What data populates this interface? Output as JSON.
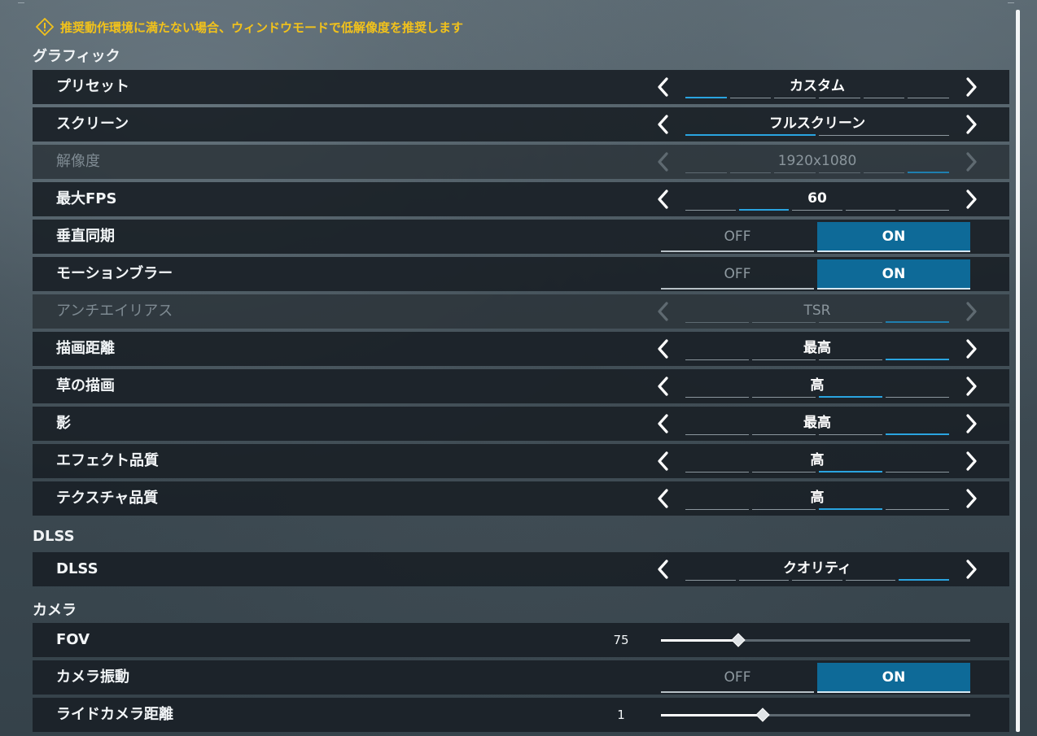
{
  "warning": {
    "icon": "warning-icon",
    "text": "推奨動作環境に満たない場合、ウィンドウモードで低解像度を推奨します",
    "color": "#f2c21b"
  },
  "colors": {
    "accent": "#2aa4e0",
    "toggle_on": "#0e6a98",
    "warning": "#f2c21b"
  },
  "sections": {
    "graphics": {
      "title": "グラフィック",
      "preset": {
        "label": "プリセット",
        "value": "カスタム",
        "segments": 6,
        "active": 0
      },
      "screen": {
        "label": "スクリーン",
        "value": "フルスクリーン",
        "segments": 2,
        "active": 0
      },
      "resolution": {
        "label": "解像度",
        "value": "1920x1080",
        "segments": 6,
        "active": 5,
        "disabled": true
      },
      "max_fps": {
        "label": "最大FPS",
        "value": "60",
        "segments": 5,
        "active": 1
      },
      "vsync": {
        "label": "垂直同期",
        "off": "OFF",
        "on": "ON",
        "state": "on"
      },
      "motion_blur": {
        "label": "モーションブラー",
        "off": "OFF",
        "on": "ON",
        "state": "on"
      },
      "anti_aliasing": {
        "label": "アンチエイリアス",
        "value": "TSR",
        "segments": 4,
        "active": 3,
        "disabled": true
      },
      "draw_distance": {
        "label": "描画距離",
        "value": "最高",
        "segments": 4,
        "active": 3
      },
      "grass": {
        "label": "草の描画",
        "value": "高",
        "segments": 4,
        "active": 2
      },
      "shadow": {
        "label": "影",
        "value": "最高",
        "segments": 4,
        "active": 3
      },
      "effects": {
        "label": "エフェクト品質",
        "value": "高",
        "segments": 4,
        "active": 2
      },
      "texture": {
        "label": "テクスチャ品質",
        "value": "高",
        "segments": 4,
        "active": 2
      }
    },
    "dlss": {
      "title": "DLSS",
      "dlss": {
        "label": "DLSS",
        "value": "クオリティ",
        "segments": 5,
        "active": 4
      }
    },
    "camera": {
      "title": "カメラ",
      "fov": {
        "label": "FOV",
        "value": "75",
        "fraction": 0.25
      },
      "shake": {
        "label": "カメラ振動",
        "off": "OFF",
        "on": "ON",
        "state": "on"
      },
      "ride_distance": {
        "label": "ライドカメラ距離",
        "value": "1",
        "fraction": 0.33
      }
    }
  }
}
